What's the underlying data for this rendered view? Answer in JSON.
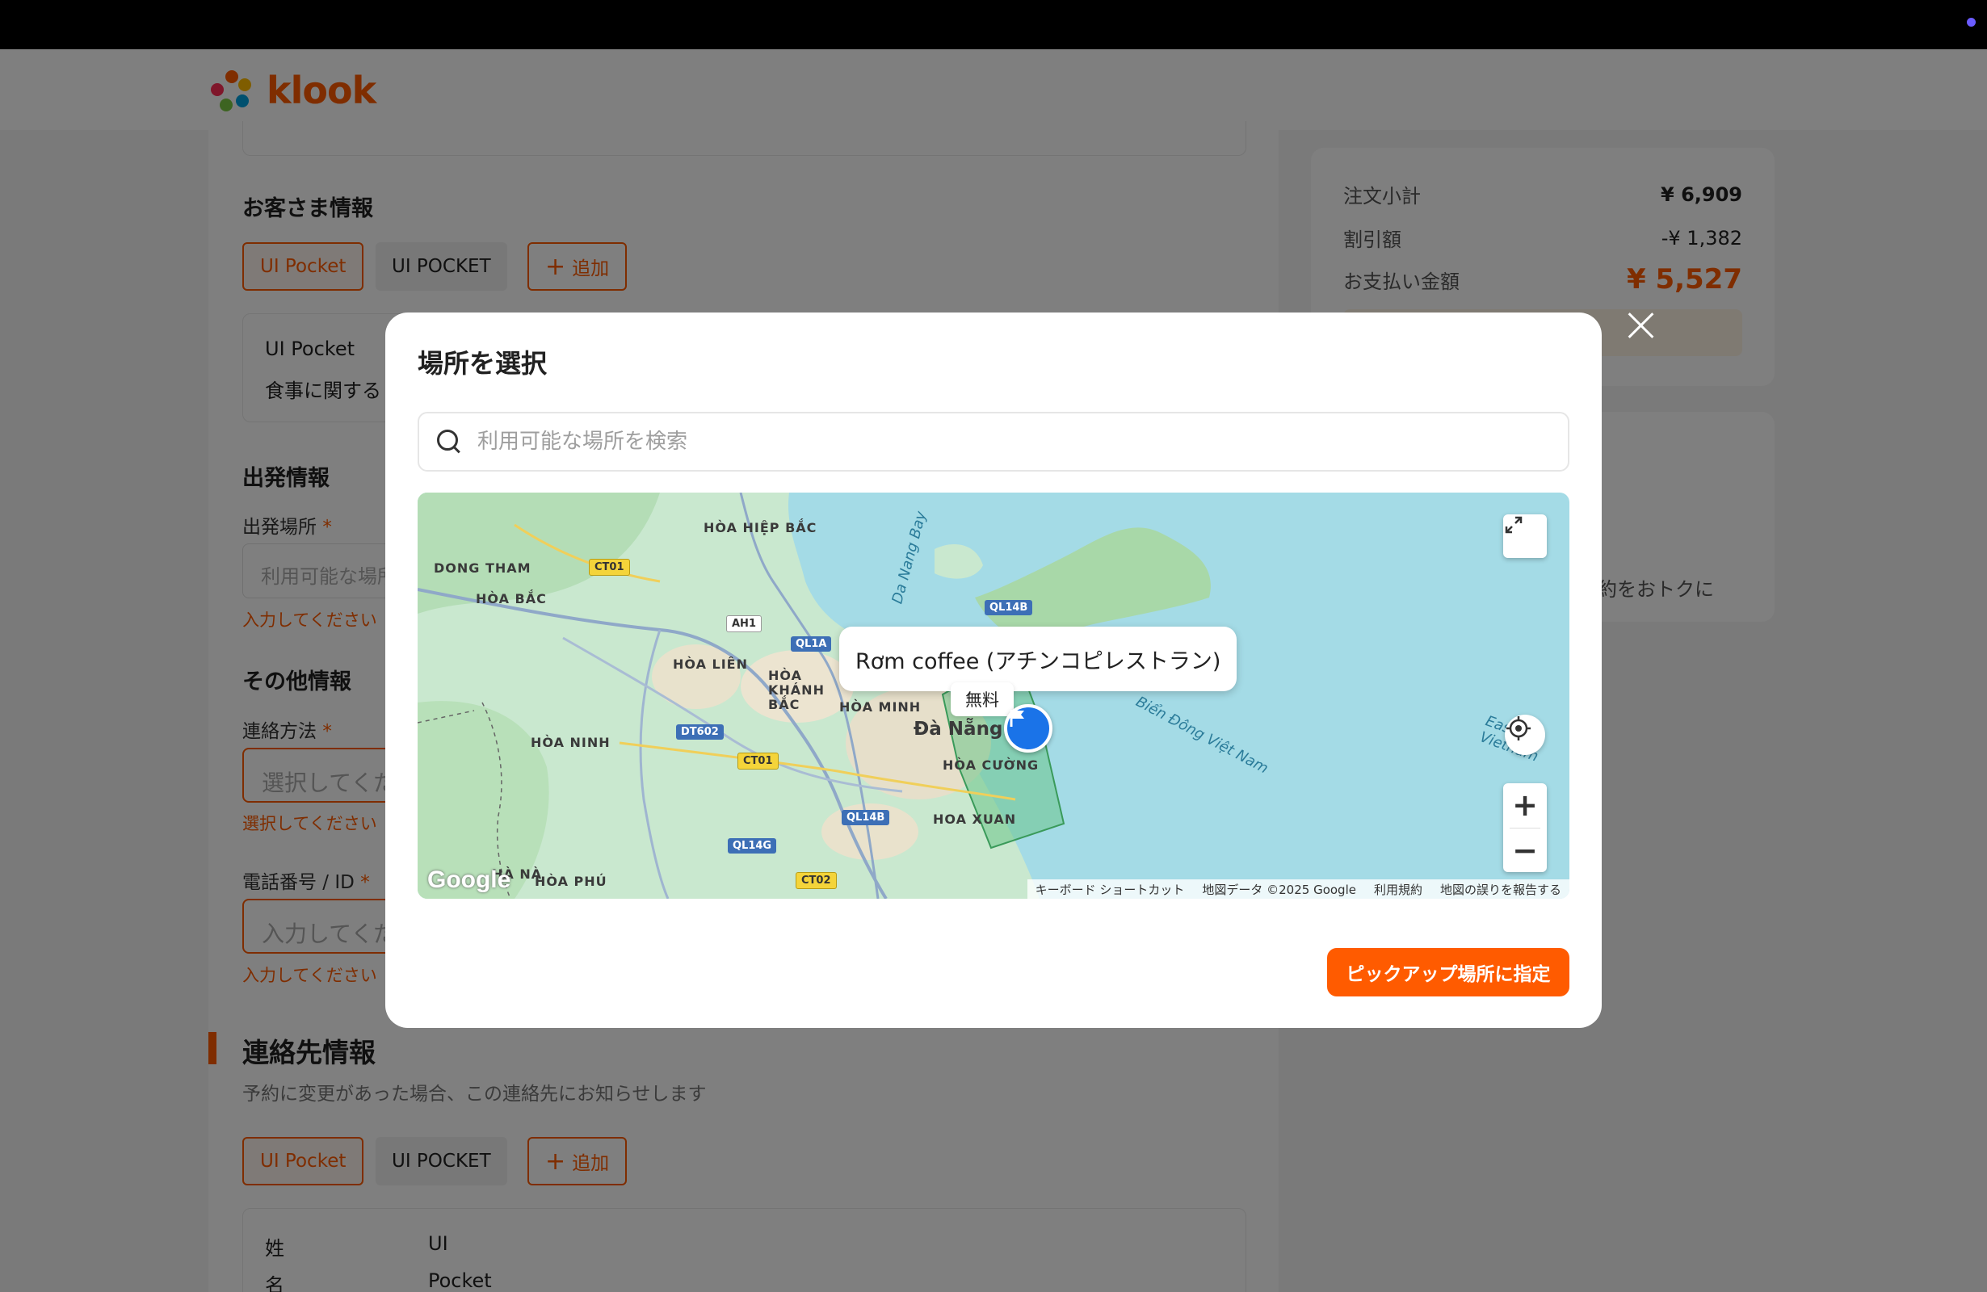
{
  "brand": {
    "name": "klook",
    "color": "#ff5b00"
  },
  "summary": {
    "subtotal_label": "注文小計",
    "subtotal_value": "¥ 6,909",
    "discount_label": "割引額",
    "discount_value": "-¥ 1,382",
    "total_label": "お支払い金額",
    "total_value": "¥ 5,527",
    "promo_text_partial": "約をおトクに"
  },
  "guest": {
    "title": "お客さま情報",
    "chips": [
      "UI Pocket",
      "UI POCKET"
    ],
    "add_label": "追加",
    "name": "UI Pocket",
    "note_partial": "食事に関する"
  },
  "departure": {
    "title": "出発情報",
    "place_label": "出発場所",
    "place_placeholder": "利用可能な場所",
    "error": "入力してください"
  },
  "other": {
    "title": "その他情報",
    "contact_label": "連絡方法",
    "contact_placeholder": "選択してくだ",
    "contact_error": "選択してください",
    "phone_label": "電話番号 / ID",
    "phone_placeholder": "入力してくだ",
    "phone_error": "入力してください"
  },
  "contact_info": {
    "title": "連絡先情報",
    "subtitle": "予約に変更があった場合、この連絡先にお知らせします",
    "chips": [
      "UI Pocket",
      "UI POCKET"
    ],
    "add_label": "追加",
    "rows": [
      {
        "label": "姓",
        "value": "UI"
      },
      {
        "label": "名",
        "value": "Pocket"
      }
    ]
  },
  "modal": {
    "title": "場所を選択",
    "search_placeholder": "利用可能な場所を検索",
    "cta_label": "ピックアップ場所に指定",
    "map": {
      "selected_place": "Rơm coffee (アチンコピレストラン)",
      "price_badge": "無料",
      "city_label": "Đà Nẵng",
      "labels": [
        "HÒA HIỆP BẮC",
        "DONG THAM",
        "HÒA BẮC",
        "HÒA LIÊN",
        "HÒA KHÁNH BẮC",
        "HÒA MINH",
        "HÒA NINH",
        "HÒA CƯỜNG",
        "HOA XUAN",
        "HÒA PHÚ",
        "HÀ NÀ"
      ],
      "roads": [
        "CT01",
        "AH1",
        "QL1A",
        "QL14B",
        "DT602",
        "CT01",
        "QL14B",
        "QL14G",
        "CT02"
      ],
      "water_labels": [
        "Da Nang Bay",
        "Biển Đông Việt Nam",
        "East Vietnam"
      ],
      "attribution": [
        "キーボード ショートカット",
        "地図データ ©2025 Google",
        "利用規約",
        "地図の誤りを報告する"
      ],
      "provider": "Google"
    }
  }
}
